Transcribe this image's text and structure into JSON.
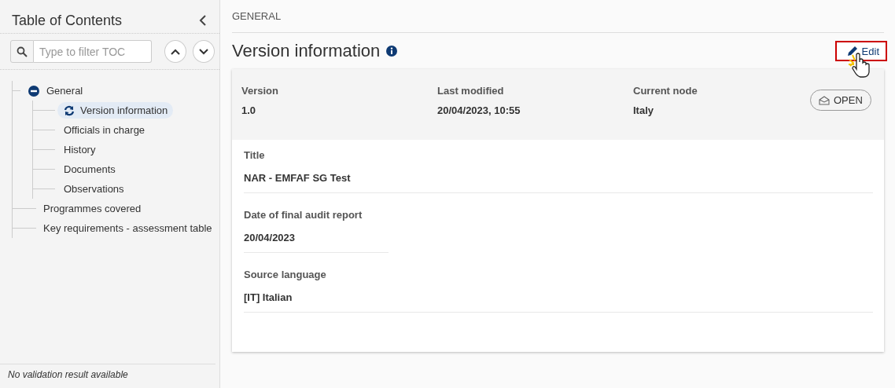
{
  "sidebar": {
    "title": "Table of Contents",
    "filter": {
      "placeholder": "Type to filter TOC"
    },
    "toc": [
      {
        "label": "General",
        "expanded": true,
        "selected": false,
        "children": [
          {
            "label": "Version information",
            "selected": true
          },
          {
            "label": "Officials in charge",
            "selected": false
          },
          {
            "label": "History",
            "selected": false
          },
          {
            "label": "Documents",
            "selected": false
          },
          {
            "label": "Observations",
            "selected": false
          }
        ]
      },
      {
        "label": "Programmes covered",
        "selected": false
      },
      {
        "label": "Key requirements - assessment table",
        "selected": false
      }
    ],
    "status": "No validation result available"
  },
  "breadcrumb": "GENERAL",
  "page_title": "Version information",
  "edit_button": "Edit",
  "summary": [
    {
      "label": "Version",
      "value": "1.0"
    },
    {
      "label": "Last modified",
      "value": "20/04/2023, 10:55"
    },
    {
      "label": "Current node",
      "value": "Italy"
    }
  ],
  "status_badge": "OPEN",
  "fields": [
    {
      "label": "Title",
      "value": "NAR - EMFAF SG Test"
    },
    {
      "label": "Date of final audit report",
      "value": "20/04/2023"
    },
    {
      "label": "Source language",
      "value": "[IT] Italian"
    }
  ]
}
